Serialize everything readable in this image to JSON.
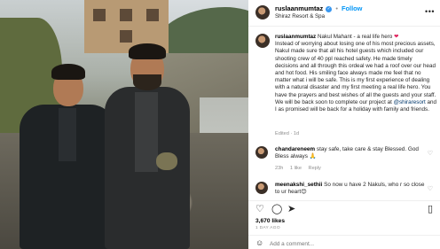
{
  "post": {
    "username": "ruslaanmumtaz",
    "follow_label": "Follow",
    "location": "Shiraz Resort & Spa",
    "more_icon": "more-horizontal-icon",
    "caption": {
      "username": "ruslaanmumtaz",
      "first_line": "Nakul Mahant - a real life hero",
      "heart": "❤",
      "body": "Instead of worrying about losing one of his most precious assets, Nakul made sure that all his hotel guests which included our shooting crew of 40 ppl reached safety. He made timely decisions and all through this ordeal we had a roof over our head and hot food. His smiling face always made me feel that no matter what i will be safe. This is my first experience of dealing with a natural disaster and my first meeting a real life hero. You have the prayers and best wishes of all the guests and your staff. We will be back soon to complete our project at",
      "tag": "@shiraresort",
      "body_end": "and I as promised will be back for a holiday with family and friends.",
      "edited": "Edited",
      "age": "1d"
    },
    "comments": [
      {
        "username": "chandareneem",
        "text": "stay safe, take care & stay Blessed. God Bless always 🙏",
        "age": "23h",
        "likes": "1 like",
        "reply": "Reply"
      },
      {
        "username": "meenakshi_sethii",
        "text": "So now u have 2 Nakuls, who r so close to ur heart😊"
      }
    ],
    "likes": "3,670 likes",
    "date": "1 DAY AGO",
    "add_comment_placeholder": "Add a comment..."
  }
}
